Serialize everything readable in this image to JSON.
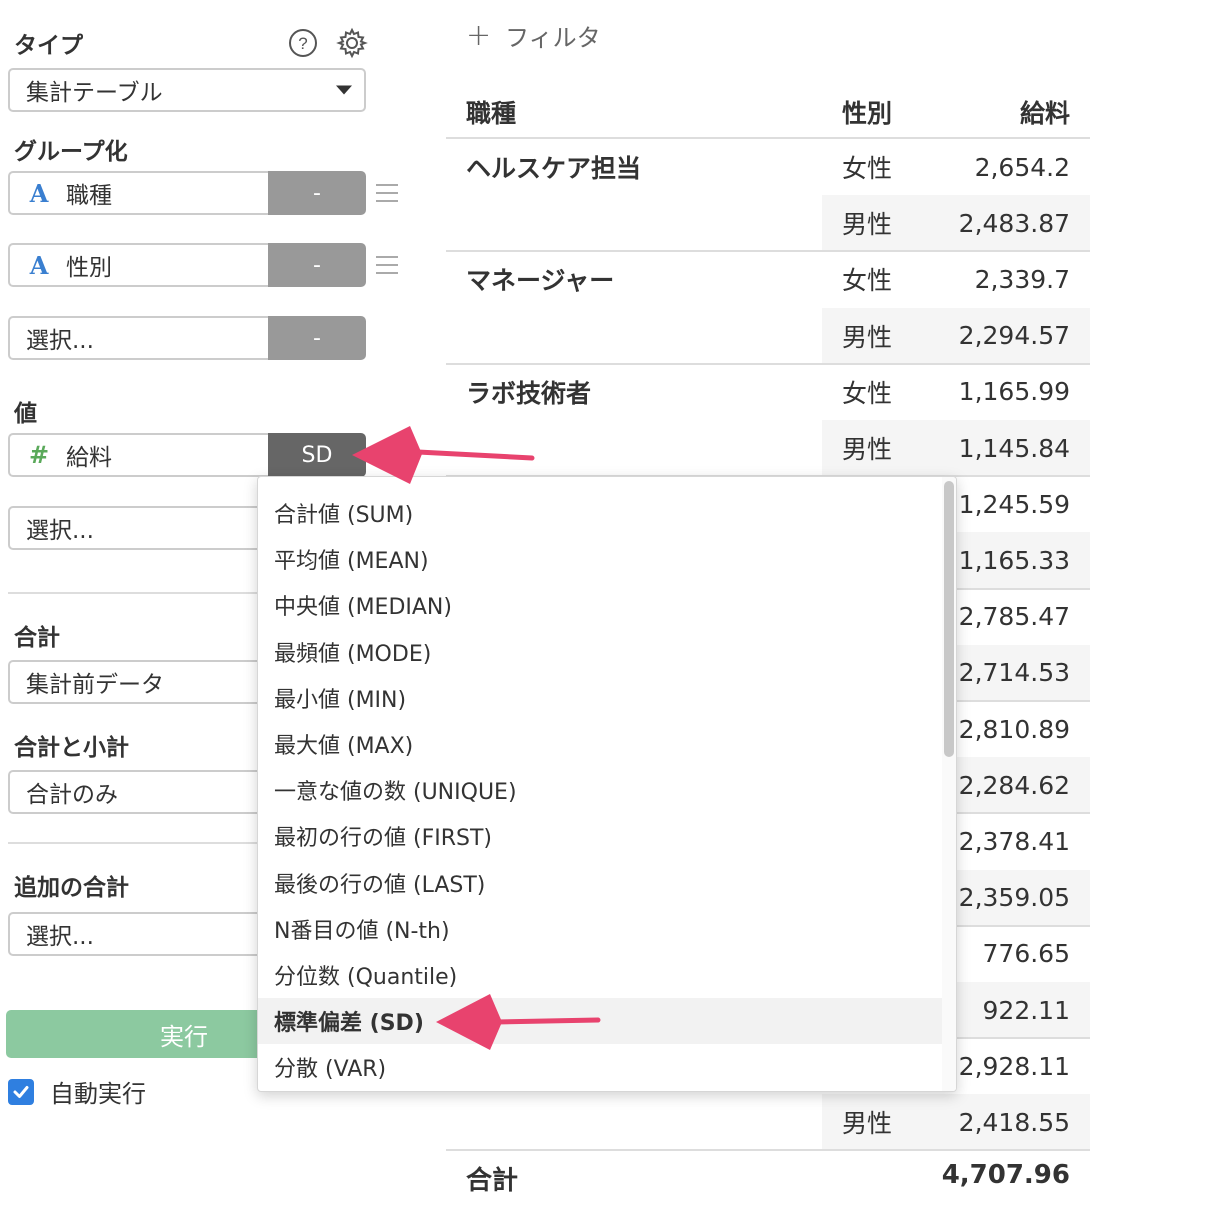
{
  "sidebar": {
    "type_label": "タイプ",
    "type_value": "集計テーブル",
    "group_label": "グループ化",
    "groups": [
      {
        "name": "職種",
        "icon": "A",
        "action": "-"
      },
      {
        "name": "性別",
        "icon": "A",
        "action": "-"
      },
      {
        "name": "選択...",
        "icon": "",
        "action": "-"
      }
    ],
    "value_label": "値",
    "value_field": {
      "name": "給料",
      "icon": "#",
      "agg": "SD"
    },
    "value_select_placeholder": "選択...",
    "total_label": "合計",
    "total_value": "集計前データ",
    "subtotal_label": "合計と小計",
    "subtotal_value": "合計のみ",
    "extra_total_label": "追加の合計",
    "extra_total_placeholder": "選択...",
    "run_button": "実行",
    "auto_run_label": "自動実行",
    "auto_run_checked": true
  },
  "table": {
    "filter_plus": "+",
    "filter_label": "フィルタ",
    "headers": {
      "job": "職種",
      "sex": "性別",
      "salary": "給料"
    },
    "rows": [
      {
        "job": "ヘルスケア担当",
        "sex": "女性",
        "value": "2,654.2"
      },
      {
        "job": "",
        "sex": "男性",
        "value": "2,483.87"
      },
      {
        "job": "マネージャー",
        "sex": "女性",
        "value": "2,339.7"
      },
      {
        "job": "",
        "sex": "男性",
        "value": "2,294.57"
      },
      {
        "job": "ラボ技術者",
        "sex": "女性",
        "value": "1,165.99"
      },
      {
        "job": "",
        "sex": "男性",
        "value": "1,145.84"
      },
      {
        "job": "",
        "sex": "",
        "value": "1,245.59"
      },
      {
        "job": "",
        "sex": "",
        "value": "1,165.33"
      },
      {
        "job": "",
        "sex": "",
        "value": "2,785.47"
      },
      {
        "job": "",
        "sex": "",
        "value": "2,714.53"
      },
      {
        "job": "",
        "sex": "",
        "value": "2,810.89"
      },
      {
        "job": "",
        "sex": "",
        "value": "2,284.62"
      },
      {
        "job": "",
        "sex": "",
        "value": "2,378.41"
      },
      {
        "job": "",
        "sex": "",
        "value": "2,359.05"
      },
      {
        "job": "",
        "sex": "",
        "value": "776.65"
      },
      {
        "job": "",
        "sex": "",
        "value": "922.11"
      },
      {
        "job": "",
        "sex": "",
        "value": "2,928.11"
      },
      {
        "job": "",
        "sex": "男性",
        "value": "2,418.55"
      }
    ],
    "total_label": "合計",
    "total_value": "4,707.96"
  },
  "dropdown": {
    "items": [
      "合計値 (SUM)",
      "平均値 (MEAN)",
      "中央値 (MEDIAN)",
      "最頻値 (MODE)",
      "最小値 (MIN)",
      "最大値 (MAX)",
      "一意な値の数 (UNIQUE)",
      "最初の行の値 (FIRST)",
      "最後の行の値 (LAST)",
      "N番目の値 (N-th)",
      "分位数 (Quantile)",
      "標準偏差 (SD)",
      "分散 (VAR)"
    ],
    "selected_index": 11
  },
  "colors": {
    "accent_arrow": "#e8436e",
    "run_button": "#8cc9a0",
    "checkbox": "#2f7fe0"
  }
}
